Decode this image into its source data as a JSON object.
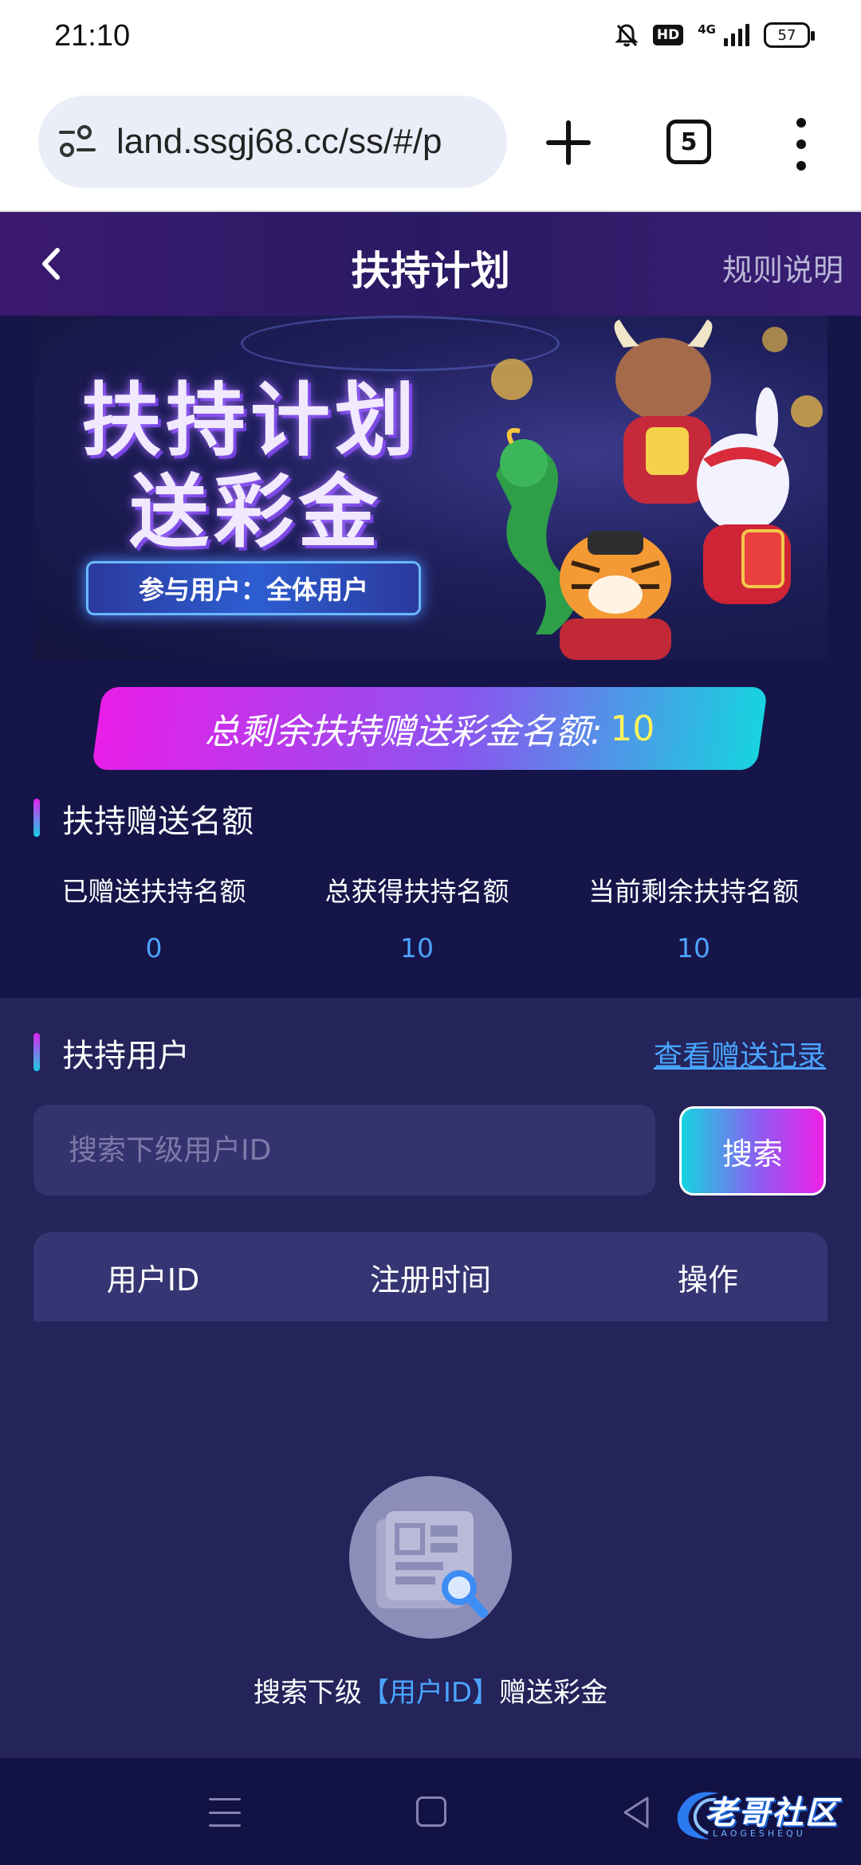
{
  "status_bar": {
    "time": "21:10",
    "network": "4G",
    "hd": "HD",
    "battery": "57"
  },
  "browser": {
    "url": "land.ssgj68.cc/ss/#/p",
    "tab_count": "5"
  },
  "header": {
    "title": "扶持计划",
    "rules": "规则说明"
  },
  "banner": {
    "title_line1": "扶持计划",
    "title_line2": "送彩金",
    "tag": "参与用户：全体用户"
  },
  "quota": {
    "label": "总剩余扶持赠送彩金名额:",
    "value": "10"
  },
  "stats_section": {
    "title": "扶持赠送名额",
    "items": [
      {
        "label": "已赠送扶持名额",
        "value": "0"
      },
      {
        "label": "总获得扶持名额",
        "value": "10"
      },
      {
        "label": "当前剩余扶持名额",
        "value": "10"
      }
    ]
  },
  "users_section": {
    "title": "扶持用户",
    "records_link": "查看赠送记录",
    "search_placeholder": "搜索下级用户ID",
    "search_button": "搜索",
    "columns": [
      "用户ID",
      "注册时间",
      "操作"
    ],
    "empty_prefix": "搜索下级",
    "empty_highlight": "【用户ID】",
    "empty_suffix": "赠送彩金"
  },
  "watermark": {
    "text": "老哥社区",
    "sub": "LAOGESHEQU"
  },
  "colors": {
    "accent_blue": "#4da3ff",
    "quota_number": "#fff35c",
    "gradient_pink": "#e91ee8",
    "gradient_cyan": "#17d3e0"
  }
}
